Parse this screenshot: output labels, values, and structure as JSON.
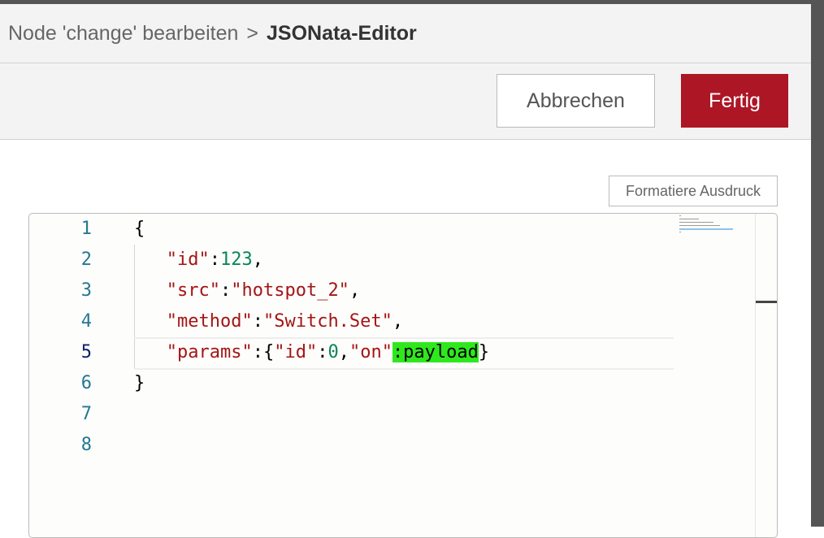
{
  "header": {
    "breadcrumb_parent": "Node 'change' bearbeiten",
    "separator": ">",
    "breadcrumb_current": "JSONata-Editor"
  },
  "toolbar": {
    "cancel_label": "Abbrechen",
    "done_label": "Fertig"
  },
  "editor": {
    "format_button_label": "Formatiere Ausdruck",
    "active_line": 5,
    "line_numbers": [
      "1",
      "2",
      "3",
      "4",
      "5",
      "6",
      "7",
      "8"
    ],
    "lines": [
      [
        {
          "t": "{",
          "c": "punct"
        }
      ],
      [
        {
          "t": "   ",
          "c": "ws"
        },
        {
          "t": "\"id\"",
          "c": "key"
        },
        {
          "t": ":",
          "c": "punct"
        },
        {
          "t": "123",
          "c": "num"
        },
        {
          "t": ",",
          "c": "punct"
        }
      ],
      [
        {
          "t": "   ",
          "c": "ws"
        },
        {
          "t": "\"src\"",
          "c": "key"
        },
        {
          "t": ":",
          "c": "punct"
        },
        {
          "t": "\"hotspot_2\"",
          "c": "str"
        },
        {
          "t": ",",
          "c": "punct"
        }
      ],
      [
        {
          "t": "   ",
          "c": "ws"
        },
        {
          "t": "\"method\"",
          "c": "key"
        },
        {
          "t": ":",
          "c": "punct"
        },
        {
          "t": "\"Switch.Set\"",
          "c": "str"
        },
        {
          "t": ",",
          "c": "punct"
        }
      ],
      [
        {
          "t": "   ",
          "c": "ws"
        },
        {
          "t": "\"params\"",
          "c": "key"
        },
        {
          "t": ":{",
          "c": "punct"
        },
        {
          "t": "\"id\"",
          "c": "key"
        },
        {
          "t": ":",
          "c": "punct"
        },
        {
          "t": "0",
          "c": "num"
        },
        {
          "t": ",",
          "c": "punct"
        },
        {
          "t": "\"on\"",
          "c": "key"
        },
        {
          "t": ":payload",
          "c": "hl"
        },
        {
          "t": "}",
          "c": "punct"
        }
      ],
      [
        {
          "t": "}",
          "c": "punct"
        }
      ],
      [],
      []
    ]
  },
  "colors": {
    "primary_button": "#ad1625",
    "highlight": "#2ee81d",
    "line_number": "#237893",
    "string": "#a31515",
    "number": "#098658"
  }
}
